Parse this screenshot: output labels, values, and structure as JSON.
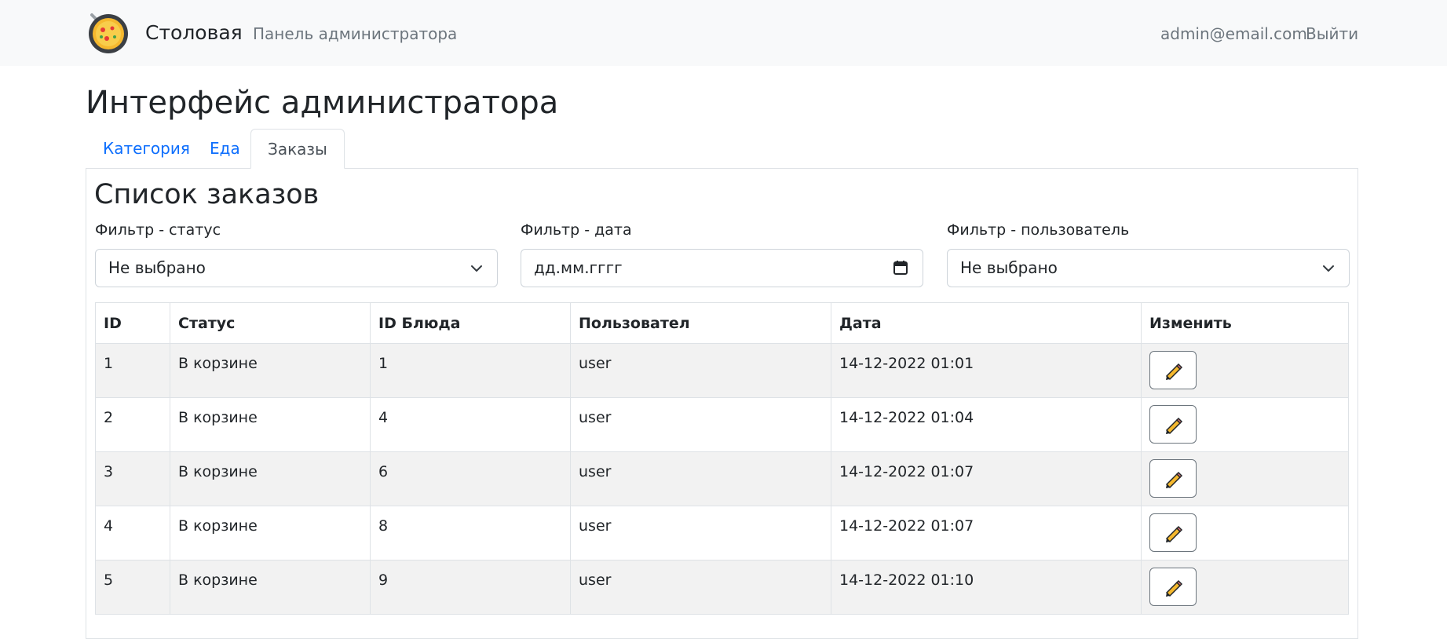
{
  "navbar": {
    "brand": "Столовая",
    "admin_link": "Панель администратора",
    "email": "admin@email.com",
    "logout": "Выйти",
    "logo_icon": "pizza-pan-icon"
  },
  "page_title": "Интерфейс администратора",
  "tabs": [
    {
      "label": "Категория",
      "active": false
    },
    {
      "label": "Еда",
      "active": false
    },
    {
      "label": "Заказы",
      "active": true
    }
  ],
  "panel": {
    "title": "Список заказов",
    "filters": {
      "status_label": "Фильтр - статус",
      "status_value": "Не выбрано",
      "date_label": "Фильтр - дата",
      "date_placeholder": "дд.мм.гггг",
      "user_label": "Фильтр - пользователь",
      "user_value": "Не выбрано"
    },
    "table": {
      "headers": [
        "ID",
        "Статус",
        "ID Блюда",
        "Пользовател",
        "Дата",
        "Изменить"
      ],
      "rows": [
        {
          "id": "1",
          "status": "В корзине",
          "dish_id": "1",
          "user": "user",
          "date": "14-12-2022 01:01"
        },
        {
          "id": "2",
          "status": "В корзине",
          "dish_id": "4",
          "user": "user",
          "date": "14-12-2022 01:04"
        },
        {
          "id": "3",
          "status": "В корзине",
          "dish_id": "6",
          "user": "user",
          "date": "14-12-2022 01:07"
        },
        {
          "id": "4",
          "status": "В корзине",
          "dish_id": "8",
          "user": "user",
          "date": "14-12-2022 01:07"
        },
        {
          "id": "5",
          "status": "В корзине",
          "dish_id": "9",
          "user": "user",
          "date": "14-12-2022 01:10"
        }
      ]
    }
  },
  "colors": {
    "navbar_bg": "#f8f9fa",
    "link": "#0d6efd",
    "muted": "#6c757d",
    "striped_row": "#f2f2f2"
  }
}
